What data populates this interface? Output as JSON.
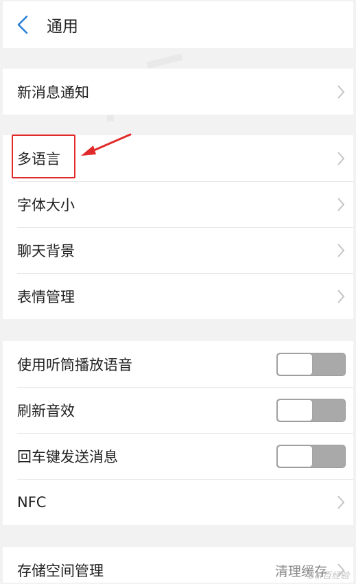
{
  "header": {
    "title": "通用"
  },
  "groups": [
    {
      "items": [
        {
          "label": "新消息通知",
          "type": "link"
        }
      ]
    },
    {
      "items": [
        {
          "label": "多语言",
          "type": "link"
        },
        {
          "label": "字体大小",
          "type": "link"
        },
        {
          "label": "聊天背景",
          "type": "link"
        },
        {
          "label": "表情管理",
          "type": "link"
        }
      ]
    },
    {
      "items": [
        {
          "label": "使用听筒播放语音",
          "type": "toggle",
          "state": "off"
        },
        {
          "label": "刷新音效",
          "type": "toggle",
          "state": "off"
        },
        {
          "label": "回车键发送消息",
          "type": "toggle",
          "state": "off"
        },
        {
          "label": "NFC",
          "type": "link"
        }
      ]
    },
    {
      "items": [
        {
          "label": "存储空间管理",
          "type": "link",
          "value": "清理缓存"
        }
      ]
    }
  ],
  "annotation": {
    "highlight_color": "#e12b2b"
  },
  "watermark": {
    "text": "Bai百经验"
  },
  "colors": {
    "accent": "#2b7fd4",
    "toggle_off": "#a9a9a9",
    "background": "#f2f2f2"
  },
  "icons": {
    "back": "chevron-left-icon",
    "row_arrow": "chevron-right-icon"
  }
}
